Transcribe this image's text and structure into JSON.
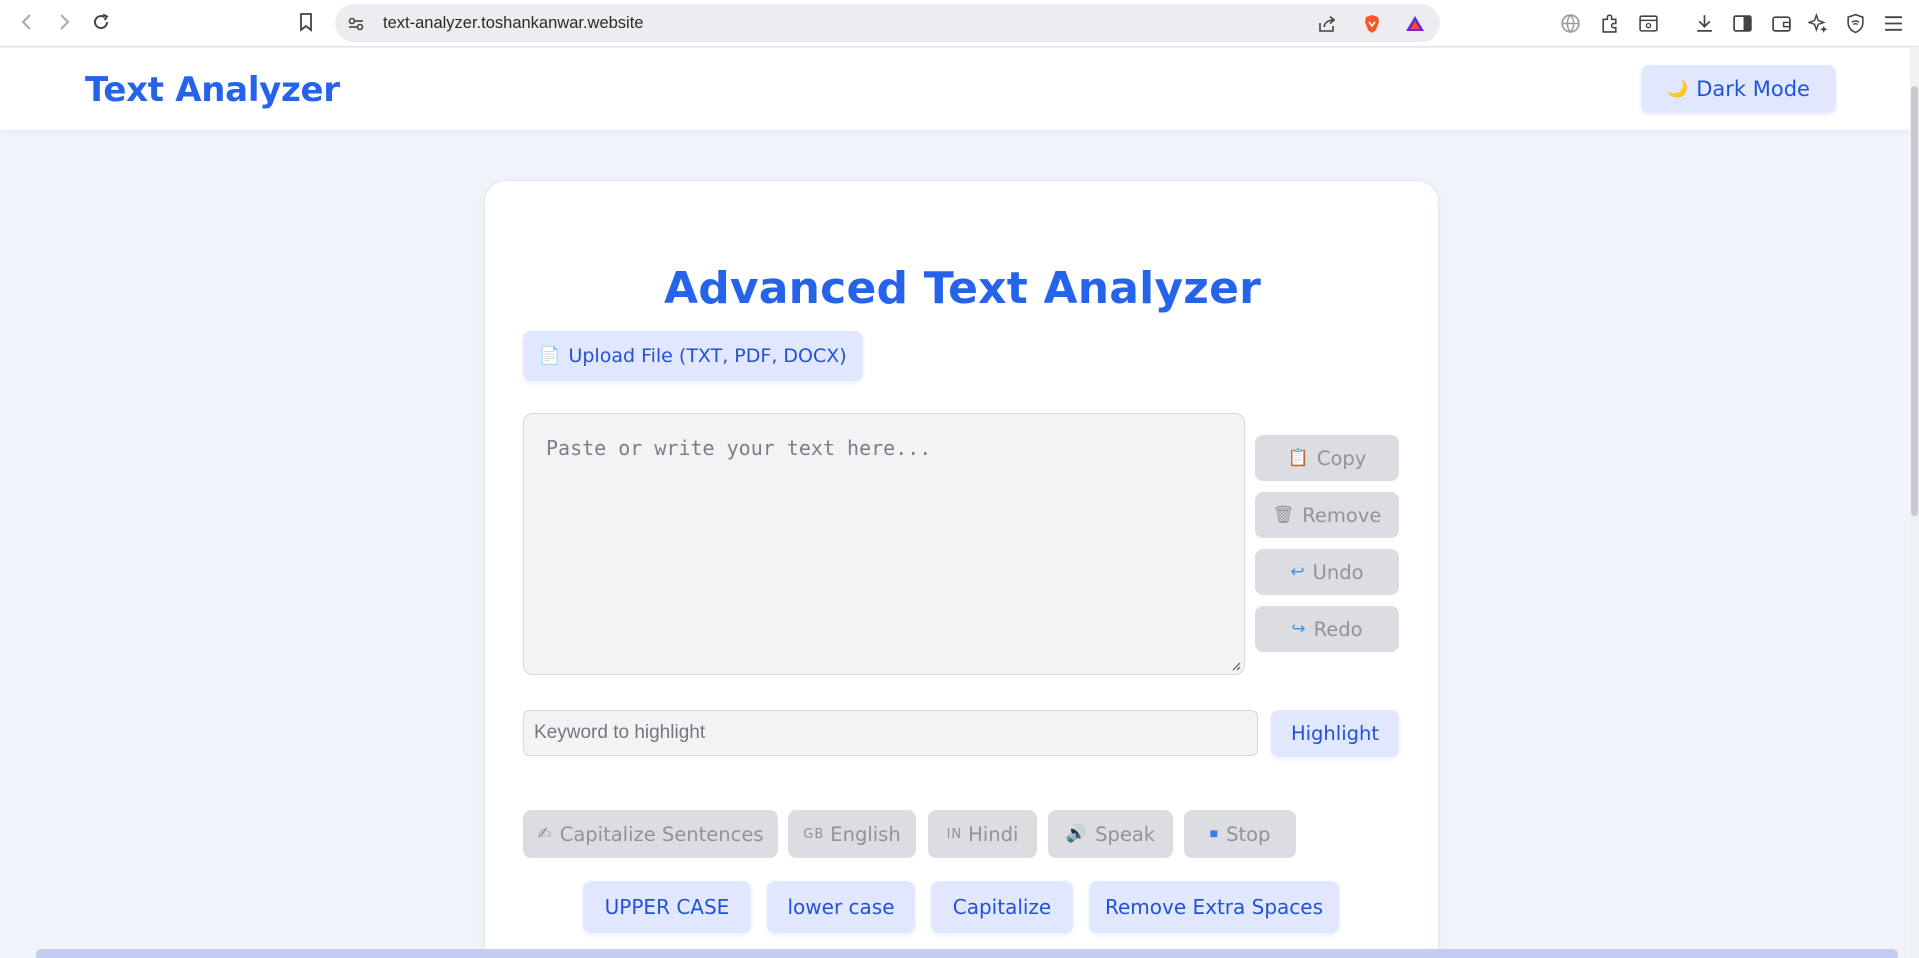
{
  "browser": {
    "url": "text-analyzer.toshankanwar.website"
  },
  "header": {
    "logo": "Text Analyzer",
    "dark_mode_icon": "🌙",
    "dark_mode_label": "Dark Mode"
  },
  "main": {
    "title": "Advanced Text Analyzer",
    "upload": {
      "icon": "📄",
      "label": "Upload File (TXT, PDF, DOCX)"
    },
    "textarea_placeholder": "Paste or write your text here...",
    "side_actions": [
      {
        "icon": "📋",
        "label": "Copy"
      },
      {
        "icon": "🗑",
        "label": "Remove"
      },
      {
        "icon": "↩",
        "label": "Undo"
      },
      {
        "icon": "↪",
        "label": "Redo"
      }
    ],
    "keyword_placeholder": "Keyword to highlight",
    "highlight_label": "Highlight",
    "tools": [
      {
        "icon": "✍",
        "label": "Capitalize Sentences"
      },
      {
        "icon": "GB",
        "label": "English"
      },
      {
        "icon": "IN",
        "label": "Hindi"
      },
      {
        "icon": "🔊",
        "label": "Speak"
      },
      {
        "icon": "⏹",
        "label": "Stop"
      }
    ],
    "case_buttons": [
      "UPPER CASE",
      "lower case",
      "Capitalize",
      "Remove Extra Spaces"
    ]
  },
  "colors": {
    "accent": "#2563eb",
    "button_bg": "#e0e7ff",
    "muted_bg": "#dcdde1",
    "page_bg": "#f1f4fa"
  }
}
